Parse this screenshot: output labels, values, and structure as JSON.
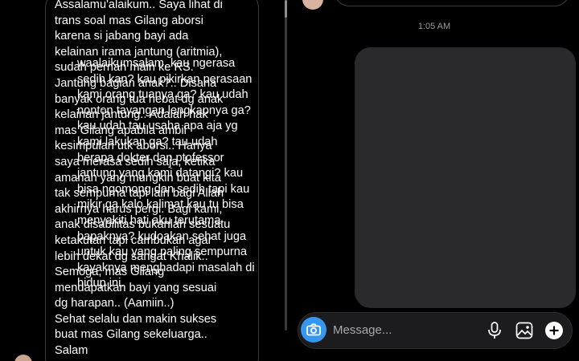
{
  "conversation": {
    "received_message": "Assalamu'alaikum.. Saya lihat di\ntrans soal mas Gilang aborsi\nkarena si jabang bayi ada\nkelainan irama jantung (aritmia),\nsudah pernah main ke RS.\nJantung bagian anak?.. Disana\nbanyak orang tua hebat dg anak\nkelainan jantung.. Adalah hak\nmas Gilang apabila ambil\nkesimpulan utk aborsi.. Hanya\nsaya merasa sedih saja, ketika\namanah yang mungkin buat kita\ntak sempurna tapi lain bagi Allah\nakhirnya harus pergi. Bagi kami,\nanak disabilitas bukanlah sesuatu\nketakutan tapi cambukan agar\nlebih dekat dg sangat Khalik..\nSemoga, mas Gilang\nmendapatkan bayi yang sesuai\ndg harapan.. (Aamiin..)\nSehat selalu dan makin sukses\nbuat mas Gilang sekeluarga..\nSalam",
    "timestamp": "1:05 AM",
    "sent_message": "waalaikumsalam, kau ngerasa\nsedih kan? kau pikirkan perasaan\nkami orang tuanya ga? kau udah\nnonton tayangan lengkapnya ga?\nkau udah tau usaha apa aja yg\nkami lakukan ga? tau udah\nberapa dokter dan ptofessor\njantung yang kami datangi? kau\nbisa ngomong dan sedih tapi kau\nmikir ga kalo kalimat kau tu bisa\nmenyakiti hati aku terutama\nbapaknya? kudoakan sehat juga\nuntuk kau yang paling sempurna\nkayaknya menghadapi masalah di\nhidup ini."
  },
  "composer": {
    "placeholder": "Message...",
    "icons": [
      "camera-icon",
      "microphone-icon",
      "gallery-icon",
      "plus-icon"
    ]
  },
  "colors": {
    "background": "#000000",
    "sent_bubble": "#2a2a2c",
    "accent": "#3797f0",
    "timestamp": "#9a9a9a",
    "placeholder": "#a8a8a8"
  }
}
